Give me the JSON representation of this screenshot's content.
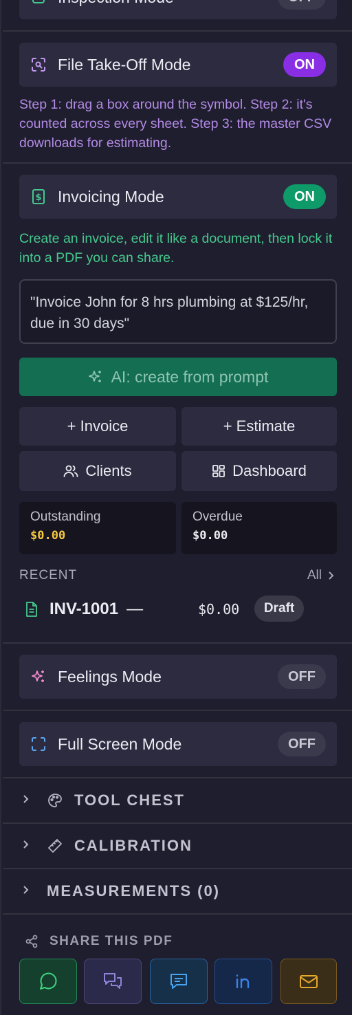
{
  "inspection": {
    "label": "Inspection Mode",
    "state": "OFF"
  },
  "takeoff": {
    "label": "File Take-Off Mode",
    "state": "ON",
    "help": "Step 1: drag a box around the symbol. Step 2: it's counted across every sheet. Step 3: the master CSV downloads for estimating."
  },
  "invoicing": {
    "label": "Invoicing Mode",
    "state": "ON",
    "help": "Create an invoice, edit it like a document, then lock it into a PDF you can share.",
    "prompt_value": "\"Invoice John for 8 hrs plumbing at $125/hr, due in 30 days\"",
    "ai_button": "AI: create from prompt",
    "buttons": {
      "invoice": "+ Invoice",
      "estimate": "+ Estimate",
      "clients": "Clients",
      "dashboard": "Dashboard"
    },
    "stats": {
      "outstanding_label": "Outstanding",
      "outstanding_value": "$0.00",
      "overdue_label": "Overdue",
      "overdue_value": "$0.00"
    },
    "recent_label": "RECENT",
    "all_label": "All",
    "recent": [
      {
        "id": "INV-1001",
        "dash": "—",
        "amount": "$0.00",
        "status": "Draft"
      }
    ]
  },
  "feelings": {
    "label": "Feelings Mode",
    "state": "OFF"
  },
  "fullscreen": {
    "label": "Full Screen Mode",
    "state": "OFF"
  },
  "sections": {
    "tool_chest": "TOOL CHEST",
    "calibration": "CALIBRATION",
    "measurements": "MEASUREMENTS (0)"
  },
  "share": {
    "label": "SHARE THIS PDF",
    "buttons": [
      "whatsapp-icon",
      "chat-bubbles-icon",
      "message-icon",
      "linkedin-icon",
      "mail-icon"
    ]
  },
  "colors": {
    "purple": "#8a2ee6",
    "green": "#0f9a6a",
    "purple_text": "#b38ae6",
    "green_text": "#45c98d",
    "outstanding": "#f5c842"
  }
}
